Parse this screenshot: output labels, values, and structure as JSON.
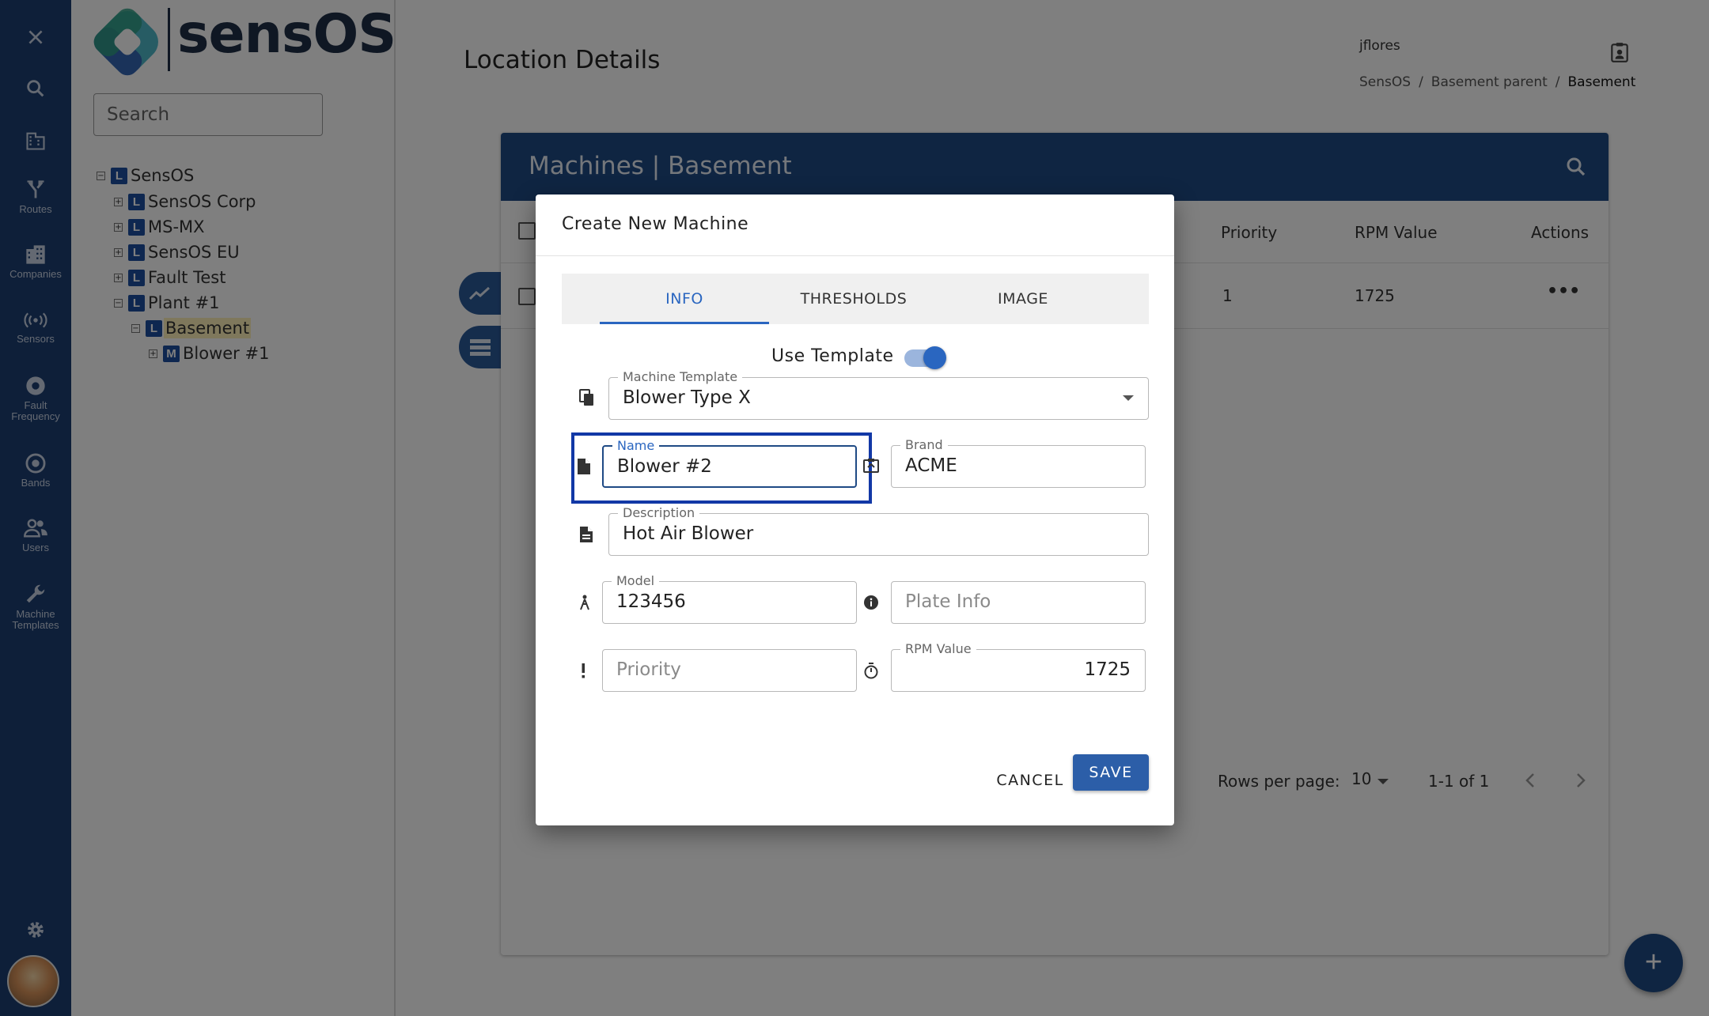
{
  "rail": {
    "items": [
      {
        "label": "",
        "icon": "close-icon"
      },
      {
        "label": "",
        "icon": "search-icon"
      },
      {
        "label": "",
        "icon": "building-icon"
      },
      {
        "label": "Routes",
        "icon": "routes-icon"
      },
      {
        "label": "Companies",
        "icon": "companies-icon"
      },
      {
        "label": "Sensors",
        "icon": "sensors-icon"
      },
      {
        "label": "Fault Frequency",
        "icon": "fault-frequency-icon"
      },
      {
        "label": "Bands",
        "icon": "bands-icon"
      },
      {
        "label": "Users",
        "icon": "users-icon"
      },
      {
        "label": "Machine Templates",
        "icon": "wrench-icon"
      }
    ],
    "settings_icon": "gear-icon"
  },
  "brand": {
    "name": "sensOS"
  },
  "tree": {
    "search_placeholder": "Search",
    "nodes": [
      {
        "label": "SensOS",
        "badge": "L",
        "toggle": "−"
      },
      {
        "label": "SensOS Corp",
        "badge": "L",
        "toggle": "+"
      },
      {
        "label": "MS-MX",
        "badge": "L",
        "toggle": "+"
      },
      {
        "label": "SensOS EU",
        "badge": "L",
        "toggle": "+"
      },
      {
        "label": "Fault Test",
        "badge": "L",
        "toggle": "+"
      },
      {
        "label": "Plant #1",
        "badge": "L",
        "toggle": "−"
      },
      {
        "label": "Basement",
        "badge": "L",
        "toggle": "−",
        "selected": true
      },
      {
        "label": "Blower #1",
        "badge": "M",
        "toggle": "+"
      }
    ]
  },
  "header": {
    "title": "Location Details",
    "username": "jflores",
    "breadcrumb": [
      "SensOS",
      "/",
      "Basement parent",
      "/",
      "Basement"
    ]
  },
  "card": {
    "title": "Machines | Basement",
    "columns": [
      "Priority",
      "RPM Value",
      "Actions"
    ],
    "rows": [
      {
        "priority": "1",
        "rpm": "1725",
        "actions": "•••"
      }
    ],
    "rows_per_page_label": "Rows per page:",
    "rows_per_page": "10",
    "range": "1-1 of 1"
  },
  "fab": {
    "label": "+"
  },
  "dialog": {
    "title": "Create New Machine",
    "tabs": [
      "INFO",
      "THRESHOLDS",
      "IMAGE"
    ],
    "active_tab": "INFO",
    "use_template_label": "Use Template",
    "use_template_on": true,
    "fields": {
      "template": {
        "label": "Machine Template",
        "value": "Blower Type X"
      },
      "name": {
        "label": "Name",
        "value": "Blower #2"
      },
      "brand": {
        "label": "Brand",
        "value": "ACME"
      },
      "description": {
        "label": "Description",
        "value": "Hot Air Blower"
      },
      "model": {
        "label": "Model",
        "value": "123456"
      },
      "plate_info": {
        "placeholder": "Plate Info"
      },
      "priority": {
        "placeholder": "Priority"
      },
      "rpm": {
        "label": "RPM Value",
        "value": "1725"
      }
    },
    "cancel_label": "CANCEL",
    "save_label": "SAVE"
  },
  "colors": {
    "rail": "#1c3f73",
    "card_header": "#1f4a85",
    "accent": "#2a66c0",
    "highlight": "#1238a6"
  }
}
